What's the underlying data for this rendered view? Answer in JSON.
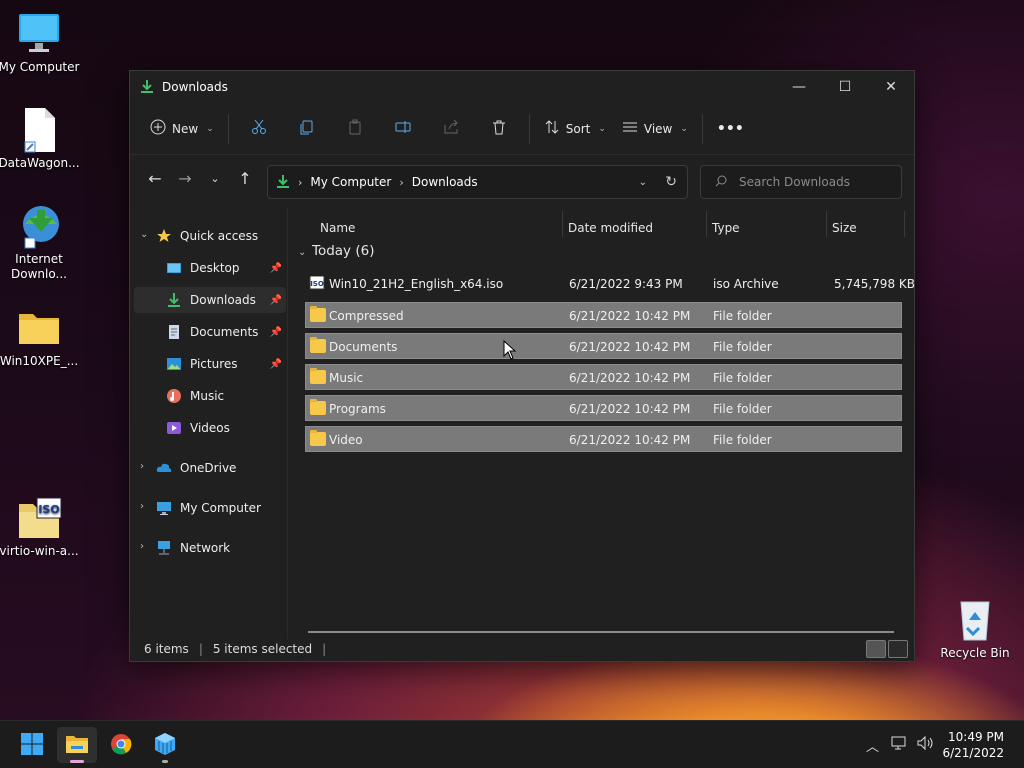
{
  "desktop": {
    "icons": [
      {
        "label": "My Computer"
      },
      {
        "label": "DataWagon..."
      },
      {
        "label": "Internet Downlo..."
      },
      {
        "label": "Win10XPE_..."
      },
      {
        "label": "virtio-win-a..."
      },
      {
        "label": "Recycle Bin"
      }
    ]
  },
  "window": {
    "title": "Downloads",
    "controls": {
      "minimize": "—",
      "maximize": "☐",
      "close": "✕"
    },
    "toolbar": {
      "new_label": "New",
      "sort_label": "Sort",
      "view_label": "View",
      "more_label": "•••"
    },
    "address": {
      "crumbs": [
        "My Computer",
        "Downloads"
      ]
    },
    "search": {
      "placeholder": "Search Downloads"
    },
    "sidebar": {
      "quick_access": "Quick access",
      "items": [
        {
          "label": "Desktop",
          "pinned": true
        },
        {
          "label": "Downloads",
          "pinned": true,
          "selected": true
        },
        {
          "label": "Documents",
          "pinned": true
        },
        {
          "label": "Pictures",
          "pinned": true
        },
        {
          "label": "Music",
          "pinned": false
        },
        {
          "label": "Videos",
          "pinned": false
        }
      ],
      "roots": [
        {
          "label": "OneDrive"
        },
        {
          "label": "My Computer"
        },
        {
          "label": "Network"
        }
      ]
    },
    "columns": {
      "name": "Name",
      "date": "Date modified",
      "type": "Type",
      "size": "Size"
    },
    "group": {
      "label": "Today (6)"
    },
    "files": [
      {
        "name": "Win10_21H2_English_x64.iso",
        "date": "6/21/2022 9:43 PM",
        "type": "iso Archive",
        "size": "5,745,798 KB",
        "selected": false,
        "kind": "iso"
      },
      {
        "name": "Compressed",
        "date": "6/21/2022 10:42 PM",
        "type": "File folder",
        "size": "",
        "selected": true,
        "kind": "folder"
      },
      {
        "name": "Documents",
        "date": "6/21/2022 10:42 PM",
        "type": "File folder",
        "size": "",
        "selected": true,
        "kind": "folder"
      },
      {
        "name": "Music",
        "date": "6/21/2022 10:42 PM",
        "type": "File folder",
        "size": "",
        "selected": true,
        "kind": "folder"
      },
      {
        "name": "Programs",
        "date": "6/21/2022 10:42 PM",
        "type": "File folder",
        "size": "",
        "selected": true,
        "kind": "folder"
      },
      {
        "name": "Video",
        "date": "6/21/2022 10:42 PM",
        "type": "File folder",
        "size": "",
        "selected": true,
        "kind": "folder"
      }
    ],
    "status": {
      "count": "6 items",
      "selected": "5 items selected"
    }
  },
  "taskbar": {
    "clock": {
      "time": "10:49 PM",
      "date": "6/21/2022"
    }
  }
}
